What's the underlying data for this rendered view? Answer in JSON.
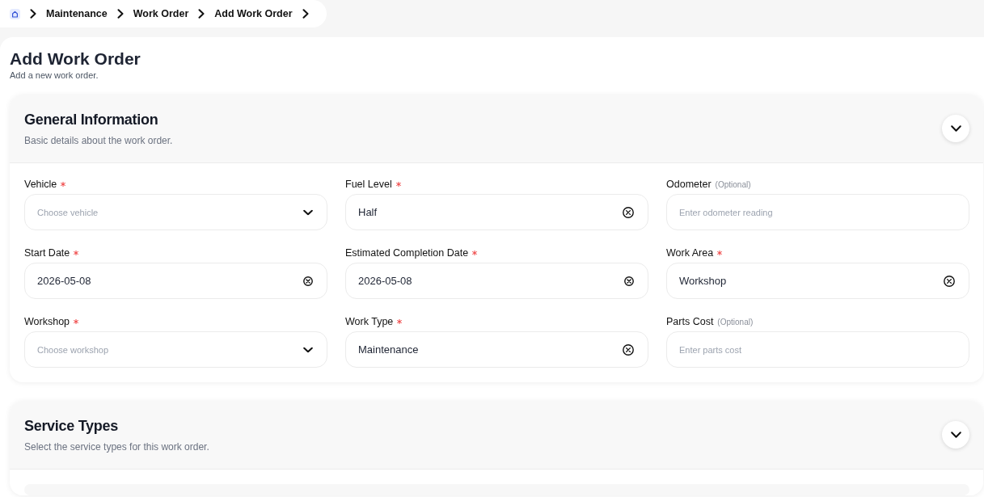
{
  "breadcrumb": [
    {
      "label": "Maintenance"
    },
    {
      "label": "Work Order"
    },
    {
      "label": "Add Work Order"
    }
  ],
  "page": {
    "title": "Add Work Order",
    "subtitle": "Add a new work order."
  },
  "sections": [
    {
      "title": "General Information",
      "subtitle": "Basic details about the work order.",
      "fields": [
        {
          "label": "Vehicle",
          "required": true,
          "kind": "select",
          "placeholder": "Choose vehicle"
        },
        {
          "label": "Fuel Level",
          "required": true,
          "kind": "clearable",
          "value": "Half"
        },
        {
          "label": "Odometer",
          "required": false,
          "hint": "(Optional)",
          "kind": "text",
          "placeholder": "Enter odometer reading"
        },
        {
          "label": "Start Date",
          "required": true,
          "kind": "date",
          "value": "2026-05-08"
        },
        {
          "label": "Estimated Completion Date",
          "required": true,
          "kind": "date",
          "value": "2026-05-08"
        },
        {
          "label": "Work Area",
          "required": true,
          "kind": "clearable",
          "value": "Workshop"
        },
        {
          "label": "Workshop",
          "required": true,
          "kind": "select",
          "placeholder": "Choose workshop"
        },
        {
          "label": "Work Type",
          "required": true,
          "kind": "clearable",
          "value": "Maintenance"
        },
        {
          "label": "Parts Cost",
          "required": false,
          "hint": "(Optional)",
          "kind": "text",
          "placeholder": "Enter parts cost"
        }
      ]
    },
    {
      "title": "Service Types",
      "subtitle": "Select the service types for this work order."
    }
  ]
}
